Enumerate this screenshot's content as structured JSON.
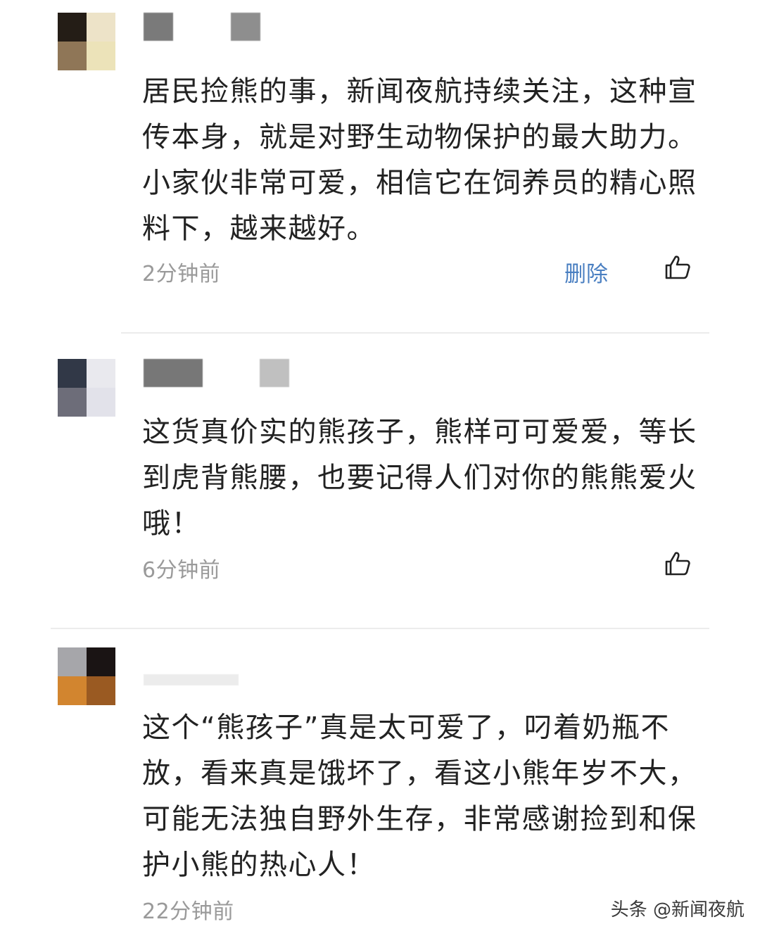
{
  "comments": [
    {
      "text": "居民捡熊的事，新闻夜航持续关注，这种宣传本身，就是对野生动物保护的最大助力。小家伙非常可爱，相信它在饲养员的精心照料下，越来越好。",
      "time": "2分钟前",
      "delete_label": "删除",
      "avatar_colors": [
        "#241d16",
        "#ede3c8",
        "#8f7657",
        "#ece3b9"
      ]
    },
    {
      "text": "这货真价实的熊孩子，熊样可可爱爱，等长到虎背熊腰，也要记得人们对你的熊熊爱火哦！",
      "time": "6分钟前",
      "avatar_colors": [
        "#313847",
        "#e9e9ee",
        "#6d6d79",
        "#e2e2ea"
      ]
    },
    {
      "text": "这个“熊孩子”真是太可爱了，叼着奶瓶不放，看来真是饿坏了，看这小熊年岁不大，可能无法独自野外生存，非常感谢捡到和保护小熊的热心人！",
      "time": "22分钟前",
      "avatar_colors": [
        "#a6a6aa",
        "#1a1414",
        "#d2852f",
        "#9a5a22"
      ]
    }
  ],
  "icons": {
    "like": "thumbs-up-icon"
  },
  "watermark": "头条 @新闻夜航"
}
